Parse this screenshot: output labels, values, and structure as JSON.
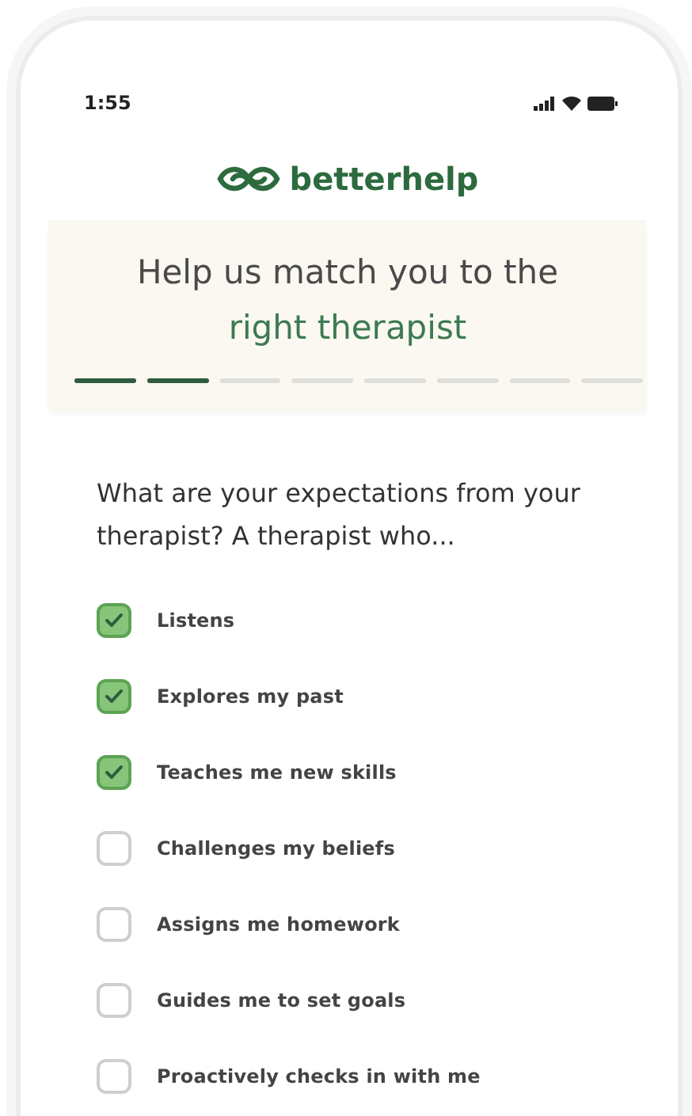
{
  "status_bar": {
    "time": "1:55"
  },
  "brand": {
    "name": "betterhelp"
  },
  "header": {
    "title": "Help us match you to the",
    "title_highlight": "right therapist",
    "progress": [
      {
        "completed": true
      },
      {
        "completed": true
      },
      {
        "completed": false
      },
      {
        "completed": false
      },
      {
        "completed": false
      },
      {
        "completed": false
      },
      {
        "completed": false
      },
      {
        "completed": false
      }
    ]
  },
  "question": "What are your expectations from your therapist? A therapist who...",
  "options": [
    {
      "label": "Listens",
      "checked": true
    },
    {
      "label": "Explores my past",
      "checked": true
    },
    {
      "label": "Teaches me new skills",
      "checked": true
    },
    {
      "label": "Challenges my beliefs",
      "checked": false
    },
    {
      "label": "Assigns me homework",
      "checked": false
    },
    {
      "label": "Guides me to set goals",
      "checked": false
    },
    {
      "label": "Proactively checks in with me",
      "checked": false
    }
  ]
}
